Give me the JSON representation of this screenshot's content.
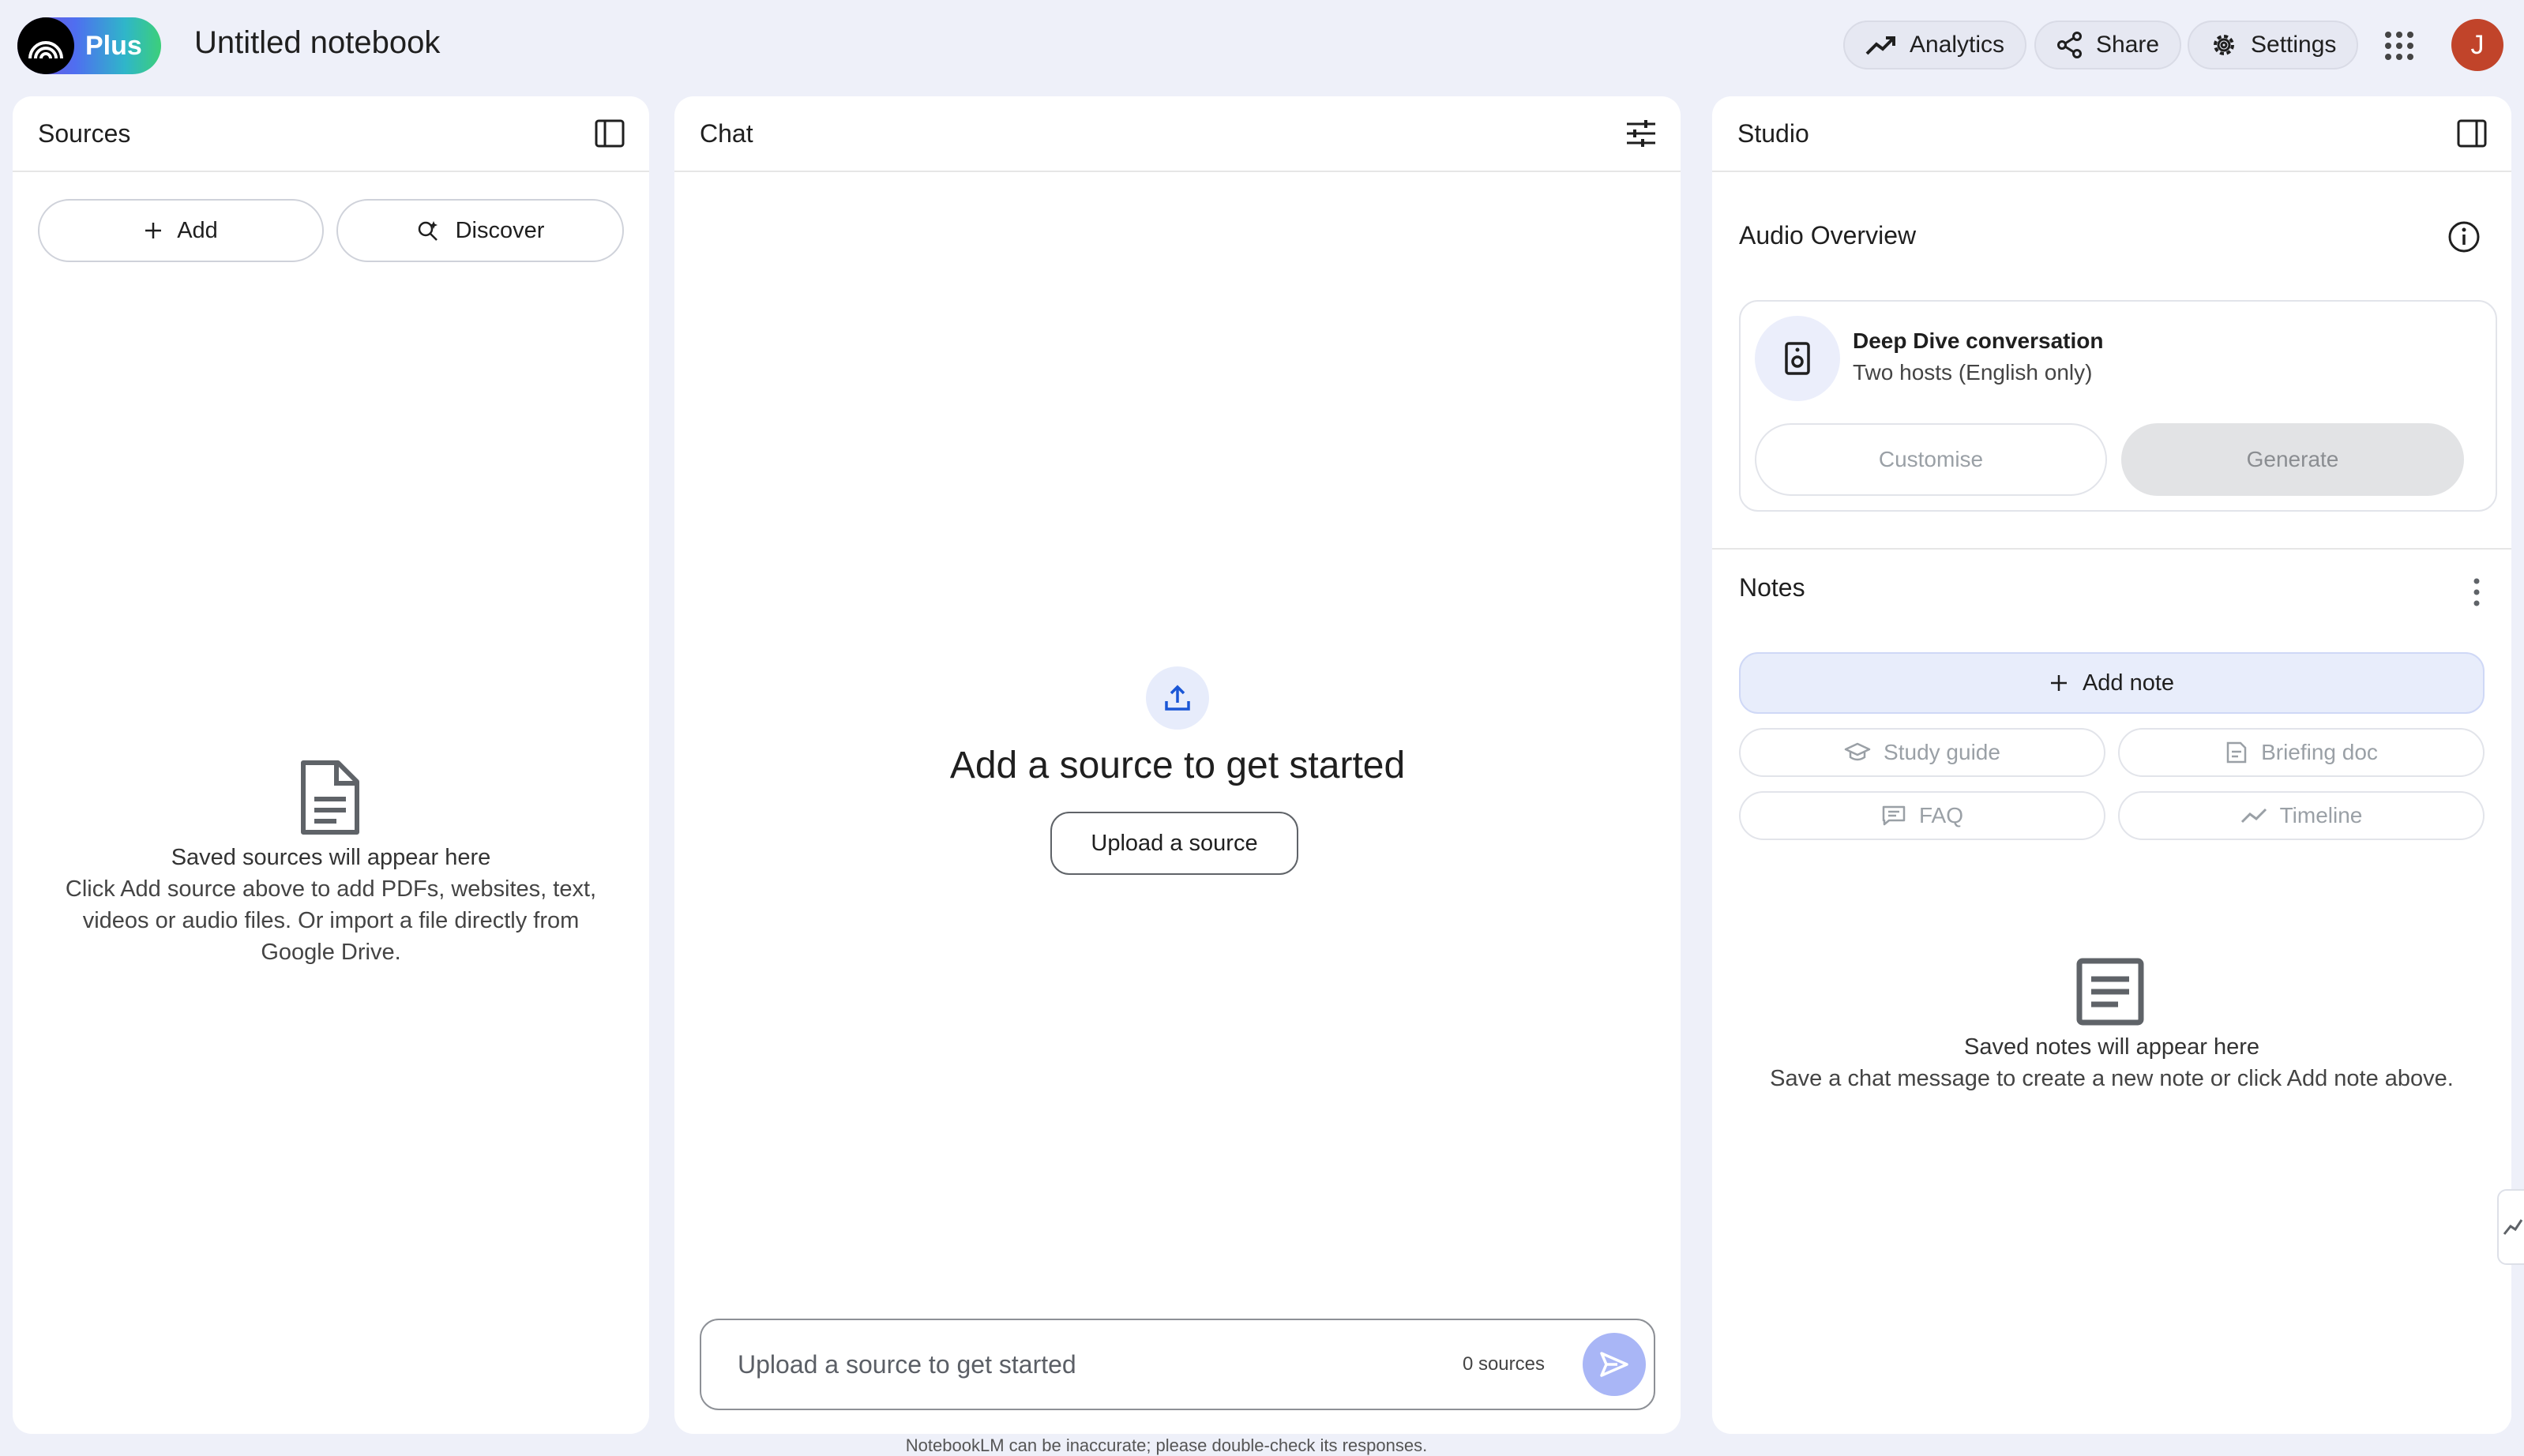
{
  "header": {
    "logo_label": "Plus",
    "notebook_title": "Untitled notebook",
    "analytics_label": "Analytics",
    "share_label": "Share",
    "settings_label": "Settings",
    "avatar_letter": "J"
  },
  "sources": {
    "title": "Sources",
    "add_label": "Add",
    "discover_label": "Discover",
    "empty_title": "Saved sources will appear here",
    "empty_line1": "Click Add source above to add PDFs, websites, text,",
    "empty_line2": "videos or audio files. Or import a file directly from",
    "empty_line3": "Google Drive."
  },
  "chat": {
    "title": "Chat",
    "heading": "Add a source to get started",
    "upload_label": "Upload a source",
    "input_placeholder": "Upload a source to get started",
    "source_count": "0 sources",
    "footer": "NotebookLM can be inaccurate; please double-check its responses."
  },
  "studio": {
    "title": "Studio",
    "audio_overview_title": "Audio Overview",
    "audio_card_title": "Deep Dive conversation",
    "audio_card_subtitle": "Two hosts (English only)",
    "customise_label": "Customise",
    "generate_label": "Generate",
    "notes_title": "Notes",
    "add_note_label": "Add note",
    "chips": [
      "Study guide",
      "Briefing doc",
      "FAQ",
      "Timeline"
    ],
    "empty_title": "Saved notes will appear here",
    "empty_subtitle": "Save a chat message to create a new note or click Add note above."
  },
  "colors": {
    "background": "#eef0f9",
    "panel": "#ffffff",
    "accent": "#a9b6f6",
    "avatar": "#c1442a"
  }
}
